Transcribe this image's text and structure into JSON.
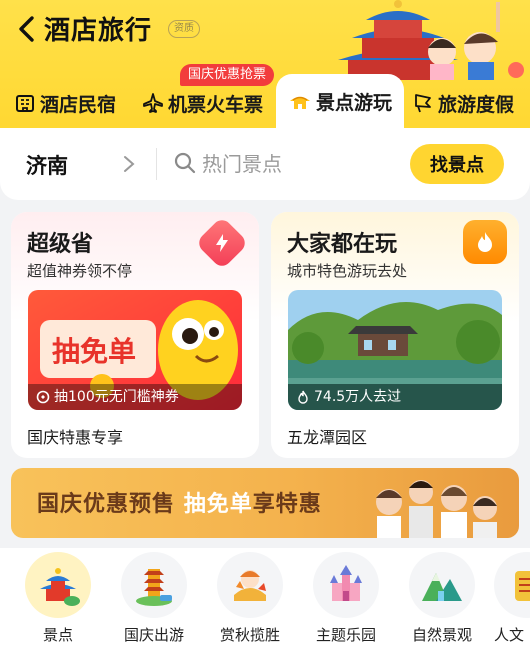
{
  "header": {
    "title": "酒店旅行",
    "qualification": "资质"
  },
  "tabs": [
    {
      "label": "酒店民宿",
      "icon": "hotel-icon"
    },
    {
      "label": "机票火车票",
      "icon": "plane-icon"
    },
    {
      "label": "景点游玩",
      "icon": "pagoda-icon",
      "active": true
    },
    {
      "label": "旅游度假",
      "icon": "flag-icon"
    }
  ],
  "promo_tag": "国庆优惠抢票",
  "search": {
    "city": "济南",
    "placeholder": "热门景点",
    "button": "找景点"
  },
  "cards": {
    "left": {
      "title": "超级省",
      "subtitle": "超值神券领不停",
      "image_main": "抽免单",
      "caption": "抽100元无门槛神券",
      "label": "国庆特惠专享",
      "icon": "lightning-icon"
    },
    "right": {
      "title": "大家都在玩",
      "subtitle": "城市特色游玩去处",
      "caption": "74.5万人去过",
      "label": "五龙潭园区",
      "icon": "flame-icon"
    }
  },
  "banner": {
    "text_main": "国庆优惠预售",
    "text_highlight": "抽免单",
    "text_end": "享特惠"
  },
  "categories": [
    {
      "label": "景点",
      "icon": "temple-icon",
      "selected": true
    },
    {
      "label": "国庆出游",
      "icon": "pagoda-travel-icon"
    },
    {
      "label": "赏秋揽胜",
      "icon": "autumn-icon"
    },
    {
      "label": "主题乐园",
      "icon": "castle-icon"
    },
    {
      "label": "自然景观",
      "icon": "mountain-icon"
    },
    {
      "label": "人文",
      "icon": "culture-icon"
    }
  ],
  "colors": {
    "accent": "#ffd530",
    "promo": "#f23c3c",
    "banner": "#f4b24d"
  }
}
